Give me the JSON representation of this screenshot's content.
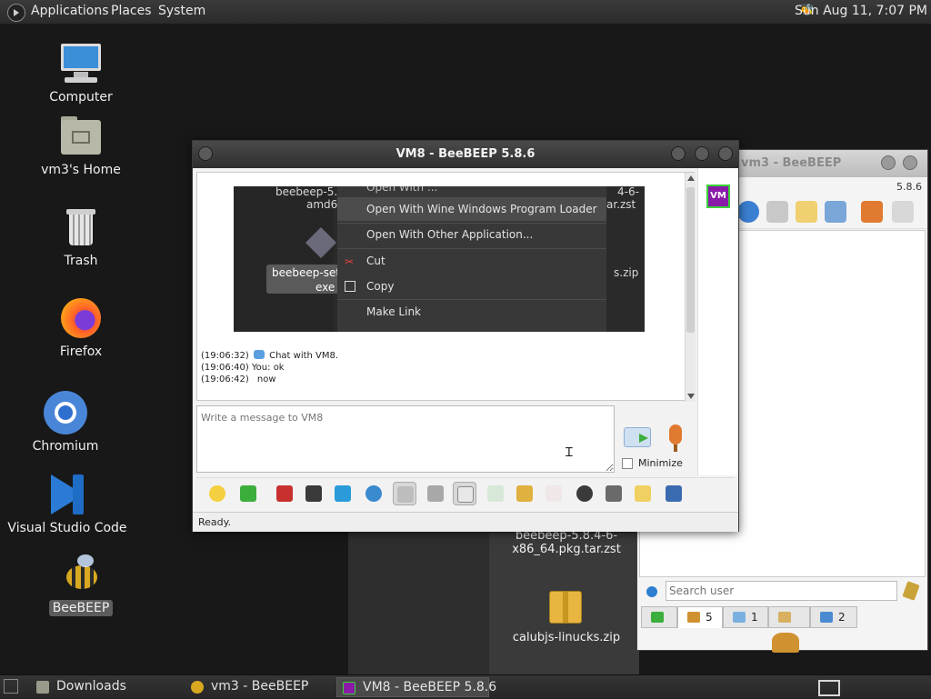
{
  "top_panel": {
    "menus": [
      "Applications",
      "Places",
      "System"
    ],
    "clock": "Sun Aug 11, 7:07 PM",
    "icons": {
      "menu": "distro-logo-icon",
      "tray": "beebeep-tray-icon"
    }
  },
  "desktop": {
    "icons": [
      {
        "label": "Computer",
        "icon": "computer-icon"
      },
      {
        "label": "vm3's Home",
        "icon": "home-folder-icon"
      },
      {
        "label": "Trash",
        "icon": "trash-icon"
      },
      {
        "label": "Firefox",
        "icon": "firefox-icon"
      },
      {
        "label": "Chromium",
        "icon": "chromium-icon"
      },
      {
        "label": "Visual Studio Code",
        "icon": "vscode-icon"
      },
      {
        "label": "BeeBEEP",
        "icon": "bee-icon",
        "selected": true
      }
    ],
    "folder_files": {
      "file1_line1": "beebeep-5.8.4-6-",
      "file1_line2": "x86_64.pkg.tar.zst",
      "file2": "calubjs-linucks.zip"
    }
  },
  "vm3_window": {
    "title": "vm3 - BeeBEEP",
    "version": "5.8.6",
    "search_placeholder": "Search user",
    "tabs": [
      {
        "count": "5",
        "icon": "users-icon"
      },
      {
        "count": "1",
        "icon": "chats-icon"
      },
      {
        "count": "",
        "icon": "groups-icon"
      },
      {
        "count": "2",
        "icon": "shares-icon"
      }
    ]
  },
  "vm8_window": {
    "title": "VM8 - BeeBEEP 5.8.6",
    "avatar_label": "VM",
    "embedded_screenshot": {
      "top_cut": "Open With ...",
      "file_line1": "beebeep-5.8",
      "file_line2": "amd6",
      "right_text1": "4-6-",
      "right_text2": "ar.zst",
      "right_text3": "s.zip",
      "sel_file1": "beebeep-setu",
      "sel_file2": "exe",
      "menu": [
        "Open With Wine Windows Program Loader",
        "Open With Other Application...",
        "Cut",
        "Copy",
        "Make Link"
      ]
    },
    "messages": [
      {
        "time": "(19:06:32)",
        "text": "Chat with VM8."
      },
      {
        "time": "(19:06:40)",
        "text": "You: ok"
      },
      {
        "time": "(19:06:42)",
        "text": "now"
      }
    ],
    "input_placeholder": "Write a message to VM8",
    "minimize_label": "Minimize",
    "status": "Ready."
  },
  "taskbar": {
    "tasks": [
      {
        "label": "Downloads",
        "icon": "folder-icon"
      },
      {
        "label": "vm3 - BeeBEEP",
        "icon": "bee-icon"
      },
      {
        "label": "VM8 - BeeBEEP 5.8.6",
        "icon": "vm-icon",
        "active": true
      }
    ]
  },
  "colors": {
    "accent_avatar": "#8a1aa8",
    "avatar_border": "#3ad23a",
    "desktop_bg": "#181818"
  }
}
